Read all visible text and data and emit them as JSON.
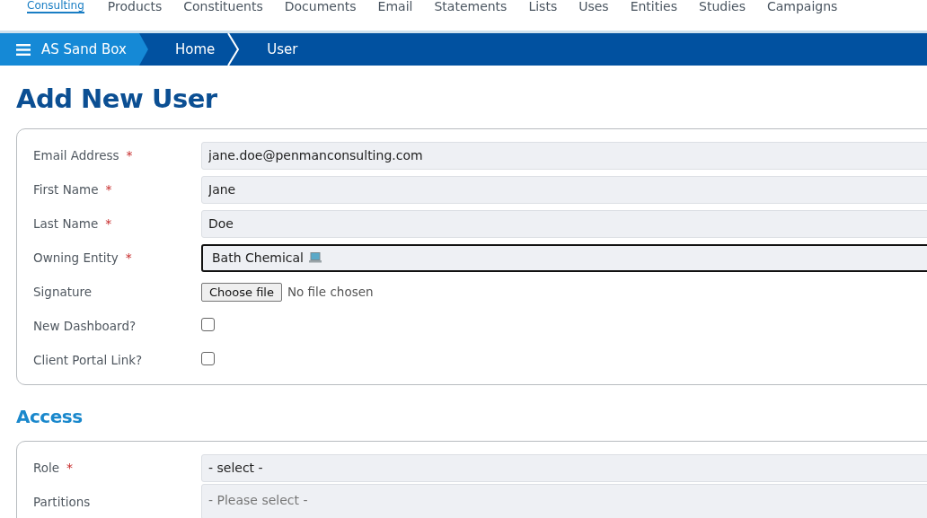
{
  "logo": {
    "text": "Consulting"
  },
  "nav": [
    "Products",
    "Constituents",
    "Documents",
    "Email",
    "Statements",
    "Lists",
    "Uses",
    "Entities",
    "Studies",
    "Campaigns"
  ],
  "breadcrumb": [
    {
      "label": "AS Sand Box",
      "kind": "root"
    },
    {
      "label": "Home",
      "kind": "crumb"
    },
    {
      "label": "User",
      "kind": "crumb"
    }
  ],
  "title": "Add New User",
  "user_fields": [
    {
      "kind": "text",
      "label": "Email Address",
      "required_mark": "*",
      "value": "jane.doe@penmanconsulting.com",
      "focused": false
    },
    {
      "kind": "text",
      "label": "First Name",
      "required_mark": "*",
      "value": "Jane",
      "focused": false
    },
    {
      "kind": "text",
      "label": "Last Name",
      "required_mark": "*",
      "value": "Doe",
      "focused": false
    },
    {
      "kind": "entity",
      "label": "Owning Entity",
      "required_mark": "*",
      "value": "Bath Chemical",
      "focused": true
    },
    {
      "kind": "file",
      "label": "Signature",
      "button": "Choose file",
      "status": "No file chosen"
    },
    {
      "kind": "checkbox",
      "label": "New Dashboard?",
      "checked": false
    },
    {
      "kind": "checkbox",
      "label": "Client Portal Link?",
      "checked": false
    }
  ],
  "access_title": "Access",
  "access_fields": [
    {
      "kind": "select",
      "label": "Role",
      "required_mark": "*",
      "value": "- select -"
    },
    {
      "kind": "multiselect",
      "label": "Partitions",
      "placeholder": "- Please select -"
    }
  ]
}
